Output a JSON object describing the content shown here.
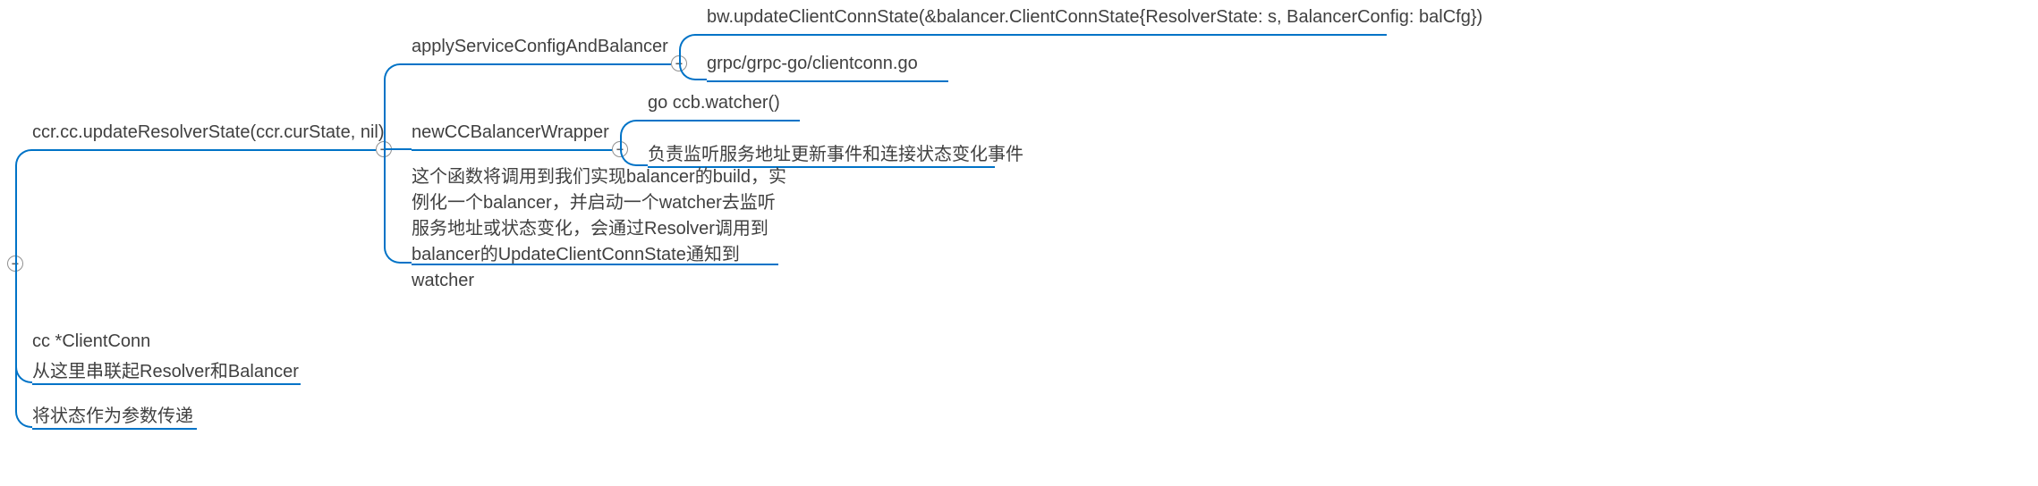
{
  "mindmap": {
    "root": {
      "label": "ccr.cc.updateResolverState(ccr.curState, nil)",
      "children": [
        {
          "label": "applyServiceConfigAndBalancer",
          "children": [
            {
              "label": "bw.updateClientConnState(&balancer.ClientConnState{ResolverState: s, BalancerConfig: balCfg})"
            },
            {
              "label": "grpc/grpc-go/clientconn.go"
            }
          ]
        },
        {
          "label": "newCCBalancerWrapper",
          "children": [
            {
              "label": "go ccb.watcher()"
            },
            {
              "label": "负责监听服务地址更新事件和连接状态变化事件"
            }
          ]
        },
        {
          "label": "这个函数将调用到我们实现balancer的build，实例化一个balancer，并启动一个watcher去监听服务地址或状态变化，会通过Resolver调用到balancer的UpdateClientConnState通知到watcher"
        }
      ]
    },
    "siblings": [
      {
        "label_line1": "cc *ClientConn",
        "label_line2": "从这里串联起Resolver和Balancer"
      },
      {
        "label": "将状态作为参数传递"
      }
    ]
  },
  "colors": {
    "line": "#0073c7"
  }
}
